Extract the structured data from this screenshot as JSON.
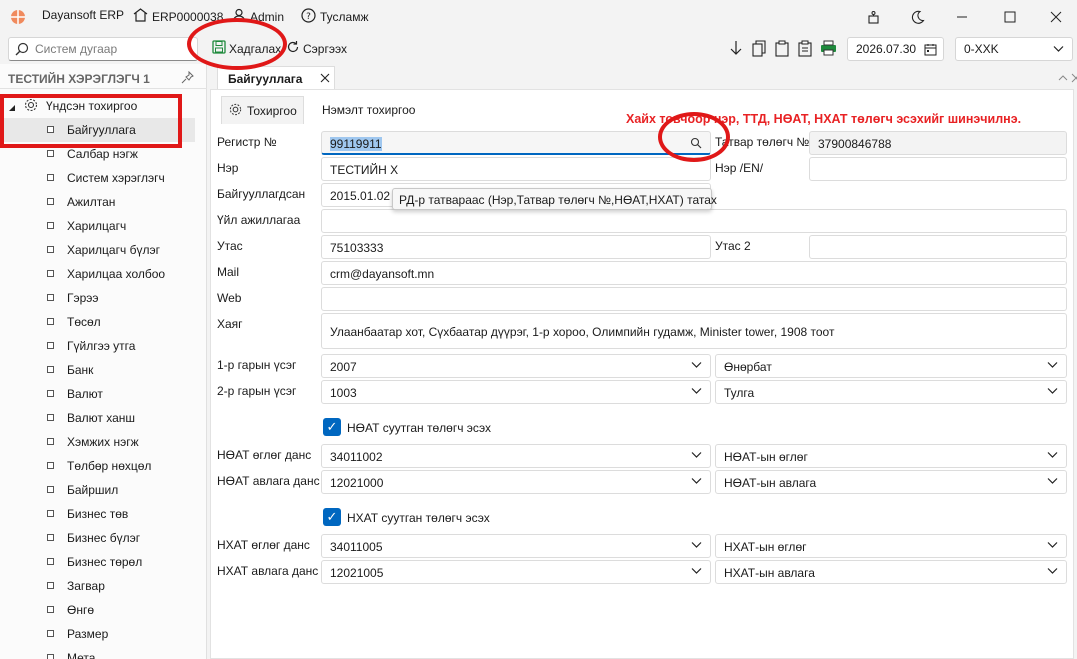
{
  "titlebar": {
    "app_name": "Dayansoft ERP",
    "company_code": "ERP0000038",
    "user": "Admin",
    "help": "Тусламж"
  },
  "toolbar": {
    "search_placeholder": "Систем дугаар",
    "save_label": "Хадгалах",
    "refresh_label": "Сэргээх",
    "date_value": "2026.07.30",
    "period_value": "0-XXK"
  },
  "sidebar": {
    "header": "ТЕСТИЙН ХЭРЭГЛЭГЧ 1",
    "root_label": "Үндсэн тохиргоо",
    "items": [
      "Байгууллага",
      "Салбар нэгж",
      "Систем хэрэглэгч",
      "Ажилтан",
      "Харилцагч",
      "Харилцагч бүлэг",
      "Харилцаа холбоо",
      "Гэрээ",
      "Төсөл",
      "Гүйлгээ утга",
      "Банк",
      "Валют",
      "Валют ханш",
      "Хэмжих нэгж",
      "Төлбөр нөхцөл",
      "Байршил",
      "Бизнес төв",
      "Бизнес бүлэг",
      "Бизнес төрөл",
      "Загвар",
      "Өнгө",
      "Размер",
      "Мета"
    ]
  },
  "main": {
    "doc_tab": "Байгууллага",
    "subtabs": [
      "Тохиргоо",
      "Нэмэлт тохиргоо"
    ],
    "hint": "Хайх товчоор нэр, ТТД, НӨАТ, НХАТ төлөгч эсэхийг шинэчилнэ.",
    "tooltip": "РД-р татвараас (Нэр,Татвар төлөгч №,НӨАТ,НХАТ) татах"
  },
  "form": {
    "register_label": "Регистр №",
    "register_value": "99119911",
    "tax_no_label": "Татвар төлөгч №",
    "tax_no_value": "37900846788",
    "name_label": "Нэр",
    "name_value": "ТЕСТИЙН Х",
    "name_en_label": "Нэр /EN/",
    "name_en_value": "",
    "founded_label": "Байгууллагдсан",
    "founded_value": "2015.01.02",
    "activity_label": "Үйл ажиллагаа",
    "activity_value": "",
    "phone_label": "Утас",
    "phone_value": "75103333",
    "phone2_label": "Утас 2",
    "phone2_value": "",
    "mail_label": "Mail",
    "mail_value": "crm@dayansoft.mn",
    "web_label": "Web",
    "web_value": "",
    "address_label": "Хаяг",
    "address_value": "Улаанбаатар хот, Сүхбаатар дүүрэг, 1-р хороо, Олимпийн гудамж, Minister tower, 1908 тоот",
    "sig1_label": "1-р гарын үсэг",
    "sig1_code": "2007",
    "sig1_name": "Өнөрбат",
    "sig2_label": "2-р гарын үсэг",
    "sig2_code": "1003",
    "sig2_name": "Тулга",
    "vat_check_label": "НӨАТ суутган төлөгч эсэх",
    "vat_payable_label": "НӨАТ өглөг данс",
    "vat_payable_code": "34011002",
    "vat_payable_name": "НӨАТ-ын өглөг",
    "vat_recv_label": "НӨАТ авлага данс",
    "vat_recv_code": "12021000",
    "vat_recv_name": "НӨАТ-ын авлага",
    "cit_check_label": "НХАТ суутган төлөгч эсэх",
    "cit_payable_label": "НХАТ өглөг данс",
    "cit_payable_code": "34011005",
    "cit_payable_name": "НХАТ-ын өглөг",
    "cit_recv_label": "НХАТ авлага данс",
    "cit_recv_code": "12021005",
    "cit_recv_name": "НХАТ-ын авлага"
  },
  "colors": {
    "accent": "#0067c0",
    "annotation_red": "#e01818",
    "hint_red": "#e82224",
    "save_icon_green": "#1e8a3c"
  }
}
